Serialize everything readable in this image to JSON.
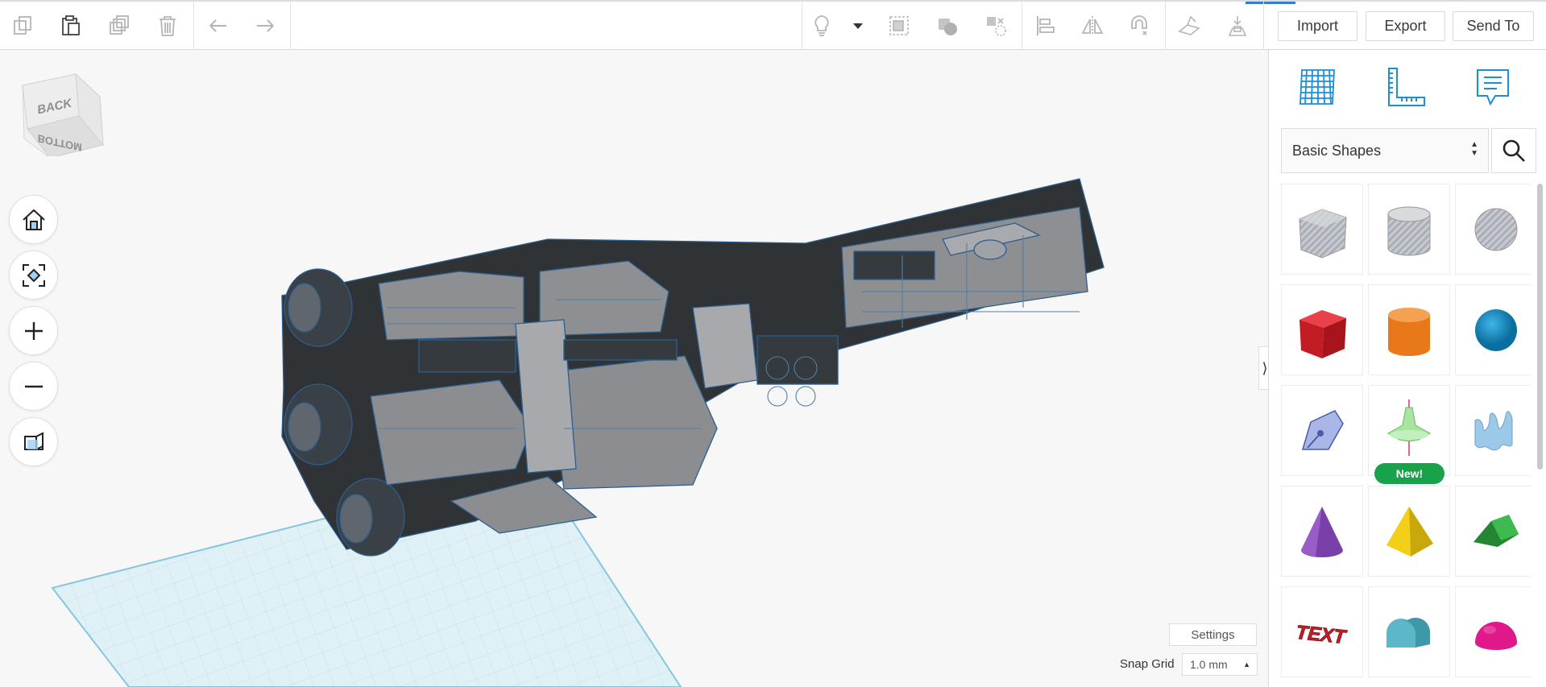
{
  "toolbar": {
    "copy_icon": "copy-icon",
    "paste_icon": "paste-icon",
    "duplicate_icon": "duplicate-icon",
    "delete_icon": "trash-icon",
    "undo_icon": "undo-icon",
    "redo_icon": "redo-icon",
    "import_label": "Import",
    "export_label": "Export",
    "send_to_label": "Send To"
  },
  "viewcube": {
    "face_back": "BACK",
    "face_bottom": "BOTTOM"
  },
  "workplane": {
    "settings_label": "Settings",
    "snap_grid_label": "Snap Grid",
    "snap_grid_value": "1.0 mm"
  },
  "panel": {
    "category": "Basic Shapes",
    "shapes": [
      {
        "name": "box-hole",
        "color": "#b8bcc4"
      },
      {
        "name": "cylinder-hole",
        "color": "#c2c5cc"
      },
      {
        "name": "sphere-hole",
        "color": "#b9bdc5"
      },
      {
        "name": "box",
        "color": "#d4202a"
      },
      {
        "name": "cylinder",
        "color": "#e8781a"
      },
      {
        "name": "sphere",
        "color": "#1a92c8"
      },
      {
        "name": "scribble",
        "color": "#aab6e8"
      },
      {
        "name": "revolver",
        "color": "#a8e6a0",
        "badge": "New!"
      },
      {
        "name": "shape-generator",
        "color": "#9dc9e8"
      },
      {
        "name": "cone",
        "color": "#7b3fa8"
      },
      {
        "name": "pyramid",
        "color": "#f2d018"
      },
      {
        "name": "roof",
        "color": "#2c9a3c"
      },
      {
        "name": "text",
        "color": "#c8202a",
        "label": "TEXT"
      },
      {
        "name": "half-cylinder",
        "color": "#5cb8c8"
      },
      {
        "name": "half-sphere",
        "color": "#e0188a"
      }
    ]
  },
  "colors": {
    "accent": "#2f7fd6",
    "new_badge": "#1aa24b",
    "model_edge": "#2c5e8e",
    "workplane": "#cfe9f2"
  }
}
